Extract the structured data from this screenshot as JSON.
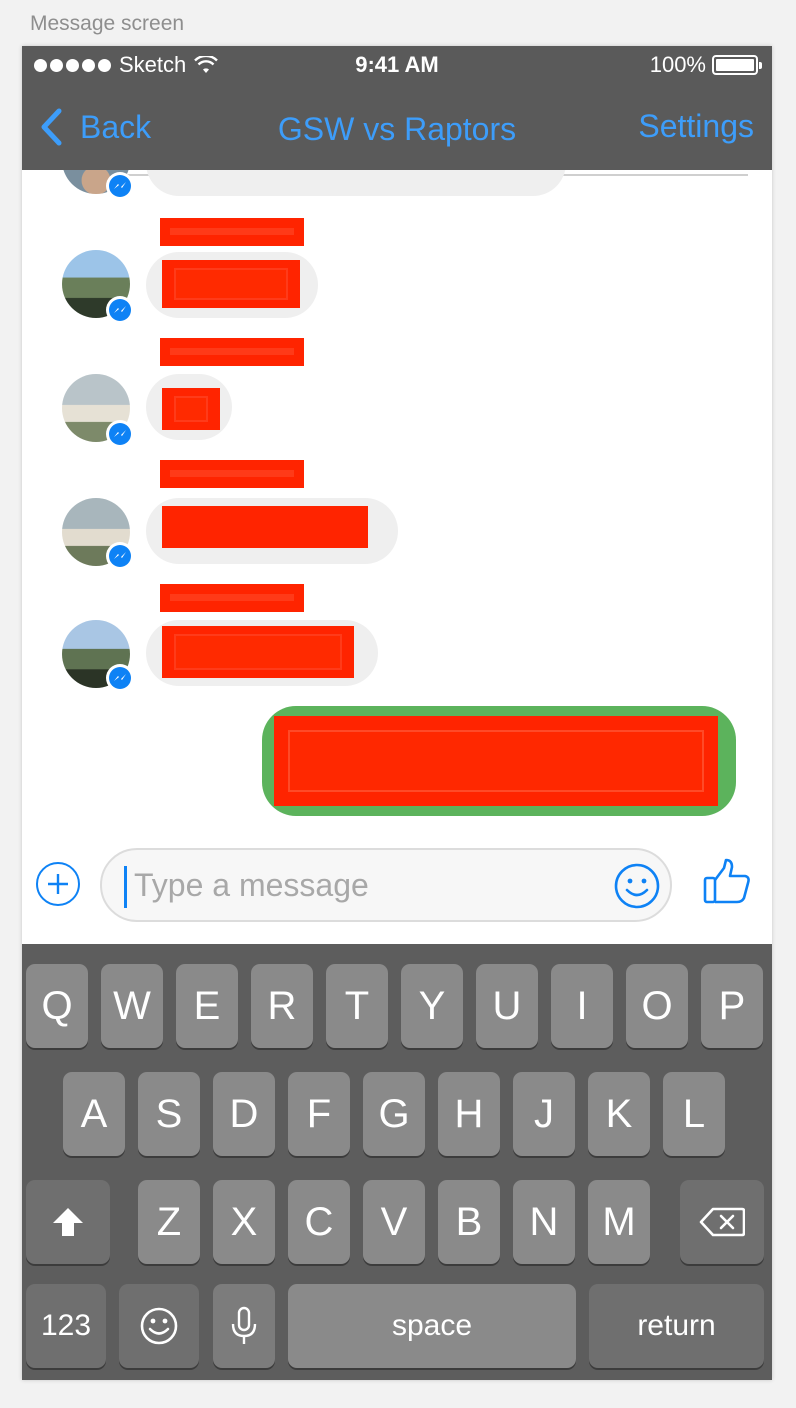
{
  "caption": "Message screen",
  "status_bar": {
    "carrier": "Sketch",
    "time": "9:41 AM",
    "battery": "100%"
  },
  "nav": {
    "back_label": "Back",
    "title": "GSW vs Raptors",
    "settings_label": "Settings"
  },
  "composer": {
    "placeholder": "Type a message"
  },
  "keyboard": {
    "row1": [
      "Q",
      "W",
      "E",
      "R",
      "T",
      "Y",
      "U",
      "I",
      "O",
      "P"
    ],
    "row2": [
      "A",
      "S",
      "D",
      "F",
      "G",
      "H",
      "J",
      "K",
      "L"
    ],
    "row3": [
      "Z",
      "X",
      "C",
      "V",
      "B",
      "N",
      "M"
    ],
    "numbers_label": "123",
    "space_label": "space",
    "return_label": "return"
  },
  "colors": {
    "accent": "#3d9dfa",
    "messenger_blue": "#0e82f5",
    "sent_bubble": "#5cb35c",
    "redaction": "#ff2400",
    "bar": "#5a5a5a"
  }
}
